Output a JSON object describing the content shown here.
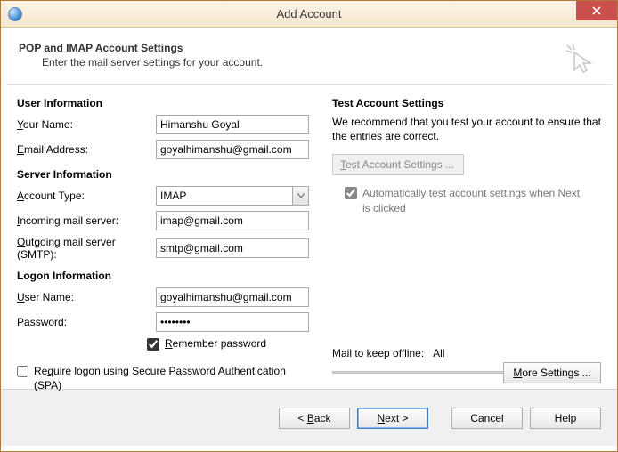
{
  "window": {
    "title": "Add Account"
  },
  "header": {
    "title": "POP and IMAP Account Settings",
    "subtitle": "Enter the mail server settings for your account."
  },
  "left": {
    "user_info_title": "User Information",
    "your_name_label": "Your Name:",
    "your_name_value": "Himanshu Goyal",
    "email_label": "Email Address:",
    "email_value": "goyalhimanshu@gmail.com",
    "server_info_title": "Server Information",
    "account_type_label": "Account Type:",
    "account_type_value": "IMAP",
    "incoming_label": "Incoming mail server:",
    "incoming_value": "imap@gmail.com",
    "outgoing_label": "Outgoing mail server (SMTP):",
    "outgoing_value": "smtp@gmail.com",
    "logon_info_title": "Logon Information",
    "user_name_label": "User Name:",
    "user_name_value": "goyalhimanshu@gmail.com",
    "password_label": "Password:",
    "password_value": "********",
    "remember_checked": true,
    "remember_label": "Remember password",
    "require_spa_checked": false,
    "require_spa_label": "Require logon using Secure Password Authentication (SPA)"
  },
  "right": {
    "title": "Test Account Settings",
    "description": "We recommend that you test your account to ensure that the entries are correct.",
    "test_button": "Test Account Settings ...",
    "auto_test_checked": true,
    "auto_test_label": "Automatically test account settings when Next is clicked",
    "mail_offline_label": "Mail to keep offline:",
    "mail_offline_value": "All",
    "more_settings": "More Settings ..."
  },
  "footer": {
    "back": "< Back",
    "next": "Next >",
    "cancel": "Cancel",
    "help": "Help"
  }
}
